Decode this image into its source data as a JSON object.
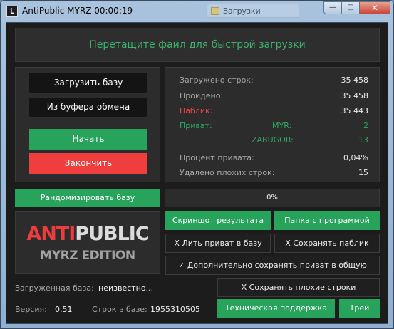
{
  "window": {
    "title": "AntiPublic MYRZ 00:00:19",
    "background_tab": "Загрузки",
    "app_icon_letter": "L",
    "minimize_glyph": "—",
    "maximize_glyph": "▢",
    "close_glyph": "✕"
  },
  "dropzone": {
    "text": "Перетащите файл для быстрой загрузки"
  },
  "left_buttons": {
    "load_base": "Загрузить базу",
    "from_clipboard": "Из буфера обмена",
    "start": "Начать",
    "finish": "Закончить"
  },
  "stats": {
    "loaded_rows_label": "Загружено строк:",
    "loaded_rows_value": "35 458",
    "passed_label": "Пройдено:",
    "passed_value": "35 458",
    "public_label": "Паблик:",
    "public_value": "35 443",
    "private_label": "Приват:",
    "myr_label": "MYR:",
    "myr_value": "2",
    "zabugor_label": "ZABUGOR:",
    "zabugor_value": "13",
    "private_percent_label": "Процент привата:",
    "private_percent_value": "0,04%",
    "bad_removed_label": "Удалено плохих строк:",
    "bad_removed_value": "15"
  },
  "randomize_button": "Рандомизировать базу",
  "progress": {
    "text": "0%",
    "fraction": 0
  },
  "actions": {
    "screenshot": "Скриншот результата",
    "program_folder": "Папка с программой",
    "pour_private": "X Лить приват в базу",
    "save_public": "X Сохранять паблик",
    "save_private_common": "✓ Дополнительно сохранять приват в общую папку",
    "save_bad_lines": "X Сохранять плохие строки",
    "support": "Техническая поддержка",
    "tray": "Трей"
  },
  "logo": {
    "part1": "ANTI",
    "part2": "PUBLIC",
    "line2": "MYRZ EDITION"
  },
  "info": {
    "loaded_base_label": "Загруженная база:",
    "loaded_base_value": "неизвестно...",
    "version_label": "Версия:",
    "version_value": "0.51",
    "rows_in_base_label": "Строк в базе:",
    "rows_in_base_value": "1955310505"
  },
  "colors": {
    "accent_green": "#27a35c",
    "accent_red": "#f03e3e",
    "background": "#1c1c1c",
    "panel": "#2c2c2c"
  }
}
